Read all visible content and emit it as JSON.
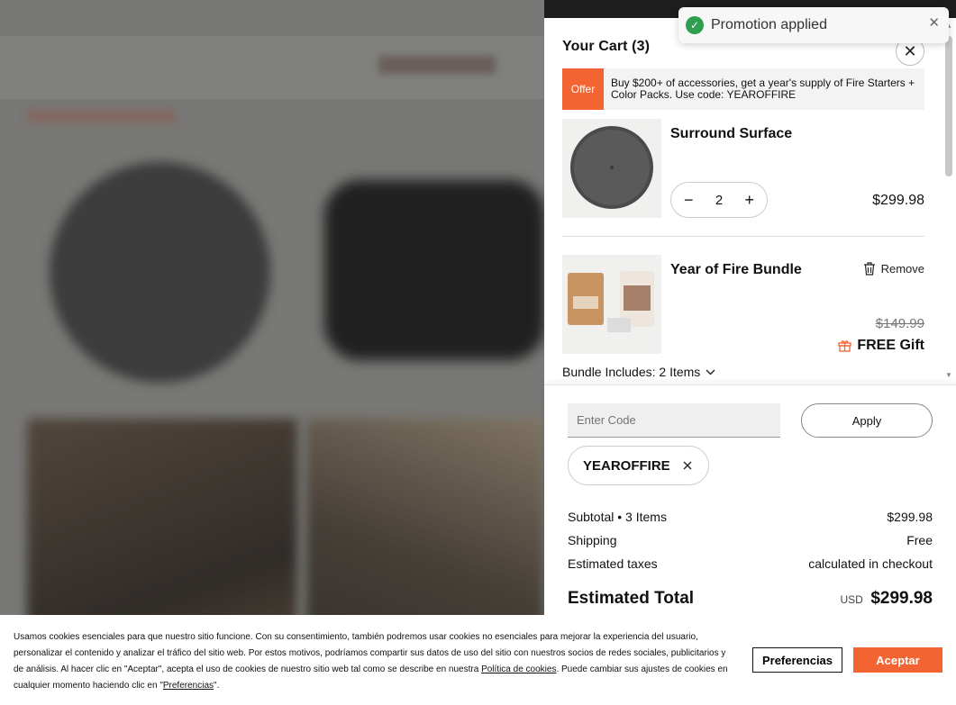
{
  "toast": {
    "message": "Promotion applied",
    "close_glyph": "✕"
  },
  "cart": {
    "title": "Your Cart (3)",
    "close_glyph": "✕",
    "offer": {
      "tag": "Offer",
      "text": "Buy $200+ of accessories, get a year's supply of Fire Starters + Color Packs. Use code: YEAROFFIRE"
    },
    "items": [
      {
        "name": "Surround Surface",
        "quantity": "2",
        "price": "$299.98",
        "minus": "−",
        "plus": "+"
      },
      {
        "name": "Year of Fire Bundle",
        "remove_label": "Remove",
        "original_price": "$149.99",
        "gift_label": "FREE Gift"
      }
    ],
    "bundle_includes": "Bundle Includes: 2 Items"
  },
  "summary": {
    "code_placeholder": "Enter Code",
    "apply_label": "Apply",
    "applied_code": "YEAROFFIRE",
    "subtotal_label": "Subtotal • 3 Items",
    "subtotal_value": "$299.98",
    "shipping_label": "Shipping",
    "shipping_value": "Free",
    "taxes_label": "Estimated taxes",
    "taxes_value": "calculated in checkout",
    "total_label": "Estimated Total",
    "currency": "USD",
    "total_value": "$299.98"
  },
  "cookie": {
    "text_part1": "Usamos cookies esenciales para que nuestro sitio funcione. Con su consentimiento, también podremos usar cookies no esenciales para mejorar la experiencia del usuario, personalizar el contenido y analizar el tráfico del sitio web. Por estos motivos, podríamos compartir sus datos de uso del sitio con nuestros socios de redes sociales, publicitarios y de análisis. Al hacer clic en \"Aceptar\", acepta el uso de cookies de nuestro sitio web tal como se describe en nuestra ",
    "policy_link": "Política de cookies",
    "text_part2": ". Puede cambiar sus ajustes de cookies en cualquier momento haciendo clic en \"",
    "pref_link": "Preferencias",
    "text_part3": "\".",
    "preferences_label": "Preferencias",
    "accept_label": "Aceptar"
  },
  "colors": {
    "accent": "#f26533",
    "success": "#2e9e4f"
  }
}
